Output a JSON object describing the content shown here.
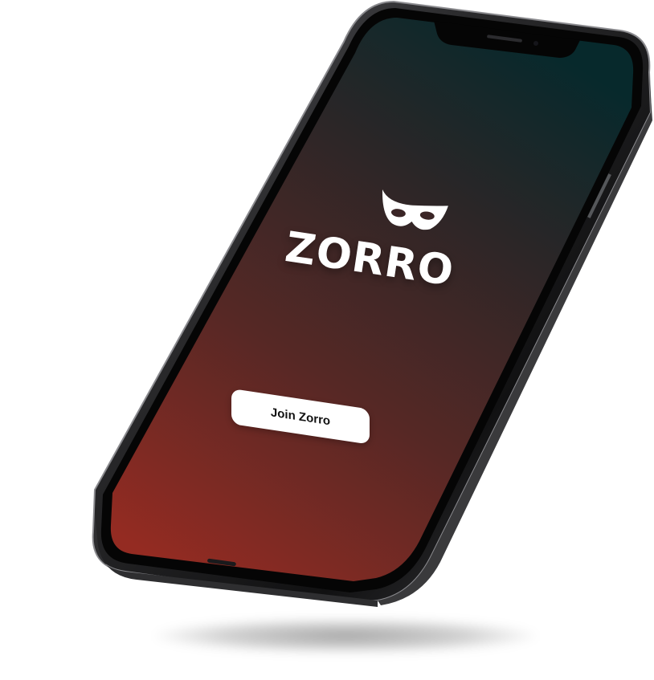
{
  "app": {
    "brand_name": "ZORRO",
    "logo_icon": "zorro-mask-icon"
  },
  "welcome": {
    "join_button_label": "Join Zorro"
  },
  "colors": {
    "gradient_top": "#0b2b2d",
    "gradient_bottom": "#8a2a22",
    "frame": "#1c1c1e",
    "button_bg": "#ffffff",
    "button_text": "#111111"
  }
}
